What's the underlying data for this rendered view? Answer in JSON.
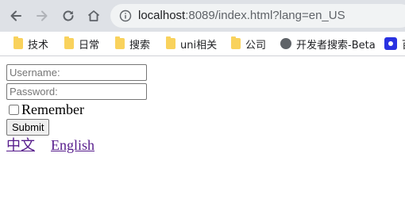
{
  "browser": {
    "url_host": "localhost",
    "url_rest": ":8089/index.html?lang=en_US",
    "icons": {
      "back": "back-arrow-icon",
      "forward": "forward-arrow-icon",
      "reload": "reload-icon",
      "home": "home-icon",
      "info": "info-icon"
    },
    "bookmarks": [
      {
        "label": "技术",
        "icon": "folder-icon"
      },
      {
        "label": "日常",
        "icon": "folder-icon"
      },
      {
        "label": "搜索",
        "icon": "folder-icon"
      },
      {
        "label": "uni相关",
        "icon": "folder-icon"
      },
      {
        "label": "公司",
        "icon": "folder-icon"
      },
      {
        "label": "开发者搜索-Beta",
        "icon": "globe-icon"
      },
      {
        "label": "百",
        "icon": "paw-icon"
      }
    ]
  },
  "login": {
    "username_placeholder": "Username:",
    "password_placeholder": "Password:",
    "remember_label": "Remember",
    "remember_checked": false,
    "submit_label": "Submit"
  },
  "languages": {
    "chinese": "中文",
    "english": "English"
  },
  "colors": {
    "toolbar_bg": "#dee1e6",
    "omnibox_bg": "#f1f3f4",
    "link_visited": "#551a8b",
    "folder": "#f9d25c"
  }
}
